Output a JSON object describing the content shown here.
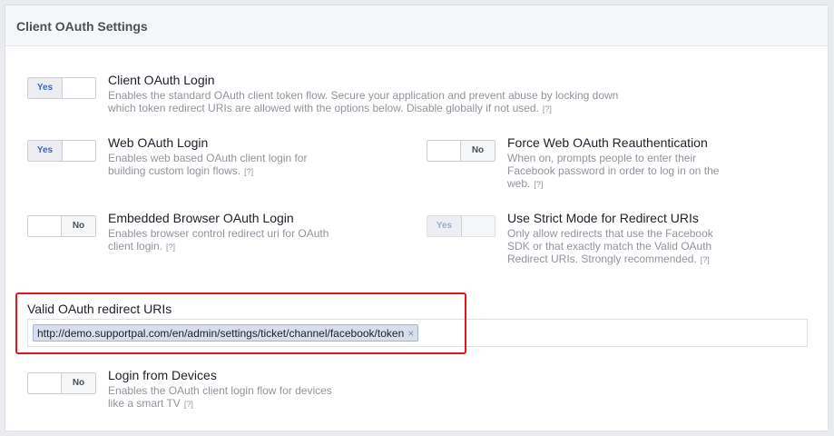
{
  "section": {
    "title": "Client OAuth Settings"
  },
  "help_marker": "[?]",
  "settings": {
    "client_oauth_login": {
      "title": "Client OAuth Login",
      "description": "Enables the standard OAuth client token flow. Secure your application and prevent abuse by locking down which token redirect URIs are allowed with the options below. Disable globally if not used.",
      "state": "Yes"
    },
    "web_oauth_login": {
      "title": "Web OAuth Login",
      "description": "Enables web based OAuth client login for building custom login flows.",
      "state": "Yes"
    },
    "force_web_oauth_reauth": {
      "title": "Force Web OAuth Reauthentication",
      "description": "When on, prompts people to enter their Facebook password in order to log in on the web.",
      "state": "No"
    },
    "embedded_browser_oauth_login": {
      "title": "Embedded Browser OAuth Login",
      "description": "Enables browser control redirect uri for OAuth client login.",
      "state": "No"
    },
    "strict_mode_redirect_uris": {
      "title": "Use Strict Mode for Redirect URIs",
      "description": "Only allow redirects that use the Facebook SDK or that exactly match the Valid OAuth Redirect URIs. Strongly recommended.",
      "state": "Yes"
    },
    "login_from_devices": {
      "title": "Login from Devices",
      "description": "Enables the OAuth client login flow for devices like a smart TV",
      "state": "No"
    }
  },
  "redirect_uris": {
    "label": "Valid OAuth redirect URIs",
    "values": [
      "http://demo.supportpal.com/en/admin/settings/ticket/channel/facebook/token"
    ],
    "remove_glyph": "×"
  },
  "colors": {
    "highlight_border": "#e4131e",
    "chip_background": "#d8dfea",
    "toggle_on_text": "#4267b2"
  }
}
